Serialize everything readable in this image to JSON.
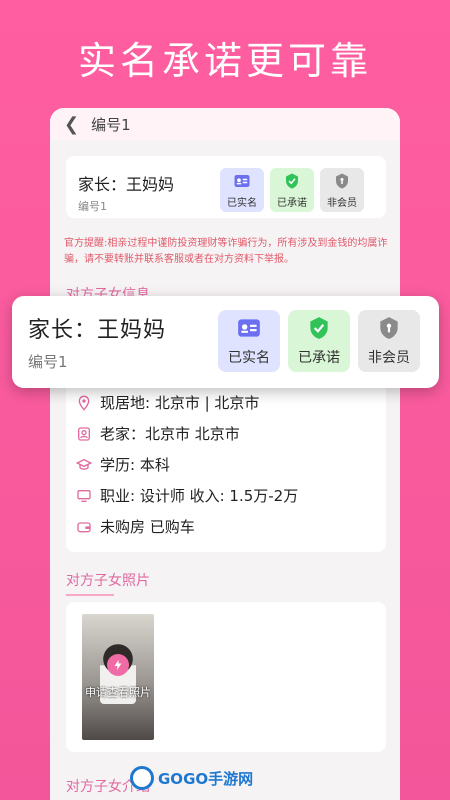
{
  "hero_title": "实名承诺更可靠",
  "nav": {
    "title": "编号1"
  },
  "profile": {
    "name": "家长：王妈妈",
    "id": "编号1",
    "badges": [
      {
        "label": "已实名",
        "icon": "id-card-icon",
        "bg": "#dfe3ff",
        "color": "#6b6ff0"
      },
      {
        "label": "已承诺",
        "icon": "check-shield-icon",
        "bg": "#d9f7d6",
        "color": "#32c25a"
      },
      {
        "label": "非会员",
        "icon": "shield-icon",
        "bg": "#e8e8e8",
        "color": "#8a8a8a"
      }
    ]
  },
  "notice": "官方提醒:相亲过程中谨防投资理财等诈骗行为，所有涉及到金钱的均属诈骗，请不要转账并联系客服或者在对方资料下举报。",
  "sections": {
    "info_title": "对方子女信息",
    "photo_title": "对方子女照片",
    "intro_title": "对方子女介绍"
  },
  "info_rows": [
    {
      "icon": "location-icon",
      "text": "现居地: 北京市 | 北京市"
    },
    {
      "icon": "hometown-icon",
      "text": "老家：北京市 北京市"
    },
    {
      "icon": "graduation-cap-icon",
      "text": "学历: 本科"
    },
    {
      "icon": "computer-icon",
      "text": "职业: 设计师 收入: 1.5万-2万"
    },
    {
      "icon": "wallet-icon",
      "text": "未购房 已购车"
    }
  ],
  "photo": {
    "overlay_text": "申请查看照片"
  },
  "watermark": {
    "text": "GOGO手游网"
  },
  "colors": {
    "accent": "#f3569a",
    "section_title": "#e06aa0",
    "notice": "#e05a6a"
  }
}
